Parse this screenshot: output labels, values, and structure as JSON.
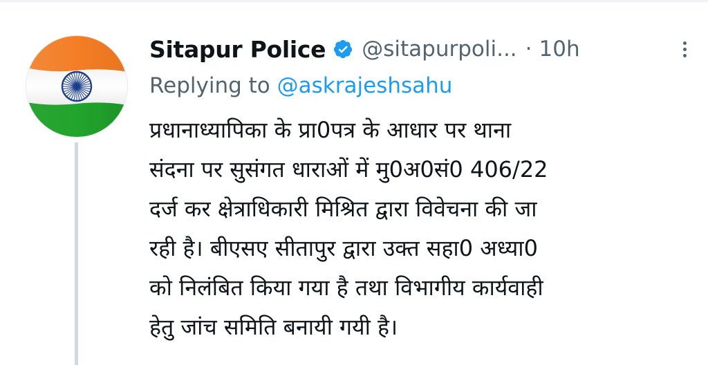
{
  "tweet": {
    "author_name": "Sitapur Police",
    "handle": "@sitapurpoli...",
    "separator": "·",
    "time": "10h",
    "replying_prefix": "Replying to",
    "replying_to": "@askrajeshsahu",
    "text_lines": [
      "प्रधानाध्यापिका के प्रा0पत्र के आधार पर थाना",
      "संदना पर सुसंगत धाराओं में मु0अ0सं0 406/22",
      "दर्ज कर क्षेत्राधिकारी मिश्रित द्वारा विवेचना की जा",
      "रही है। बीएसए सीतापुर द्वारा उक्त सहा0 अध्या0",
      "को निलंबित किया गया है तथा विभागीय कार्यवाही",
      "हेतु जांच समिति बनायी गयी है।"
    ]
  },
  "icons": {
    "verified": "verified-badge-icon",
    "more": "more-options-icon",
    "avatar": "indian-flag-avatar"
  },
  "colors": {
    "text_primary": "#0f1419",
    "text_secondary": "#536471",
    "link": "#1d9bf0",
    "thread_line": "#cfd9de",
    "saffron": "#f47e26",
    "green": "#25a52f",
    "chakra": "#1b3f8b"
  }
}
